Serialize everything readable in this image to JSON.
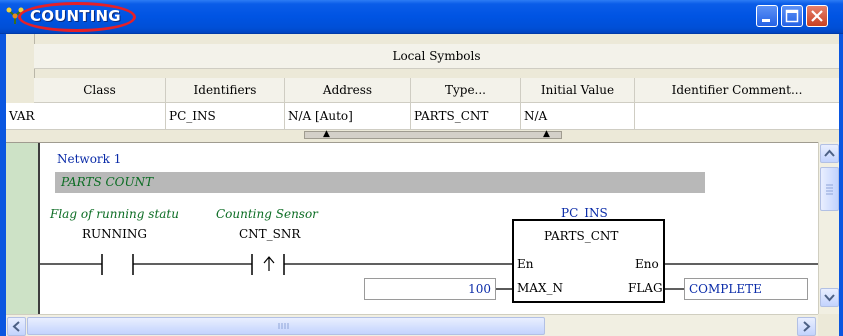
{
  "window": {
    "title": "COUNTING"
  },
  "symbols": {
    "title": "Local Symbols",
    "columns": [
      "Class",
      "Identifiers",
      "Address",
      "Type...",
      "Initial Value",
      "Identifier Comment..."
    ],
    "rows": [
      [
        "VAR",
        "PC_INS",
        "N/A [Auto]",
        "PARTS_CNT",
        "N/A",
        ""
      ]
    ]
  },
  "ladder": {
    "network_label": "Network 1",
    "network_comment": "PARTS COUNT",
    "contact1": {
      "comment": "Flag of running statu",
      "name": "RUNNING"
    },
    "contact2": {
      "comment": "Counting Sensor",
      "name": "CNT_SNR"
    },
    "block": {
      "instance": "PC_INS",
      "type": "PARTS_CNT",
      "in_en": "En",
      "out_eno": "Eno",
      "in_max": "MAX_N",
      "out_flag": "FLAG"
    },
    "input_value": "100",
    "output_var": "COMPLETE"
  },
  "colors": {
    "titlebar": "#0054e3",
    "network_text": "#0a2ba8",
    "comment_text": "#0c6d24",
    "highlight_circle": "#e52028",
    "power_rail": "#cde2c6"
  },
  "icons": {
    "app": "counting-app-icon",
    "minimize": "minimize-icon",
    "maximize": "maximize-icon",
    "close": "close-icon"
  }
}
